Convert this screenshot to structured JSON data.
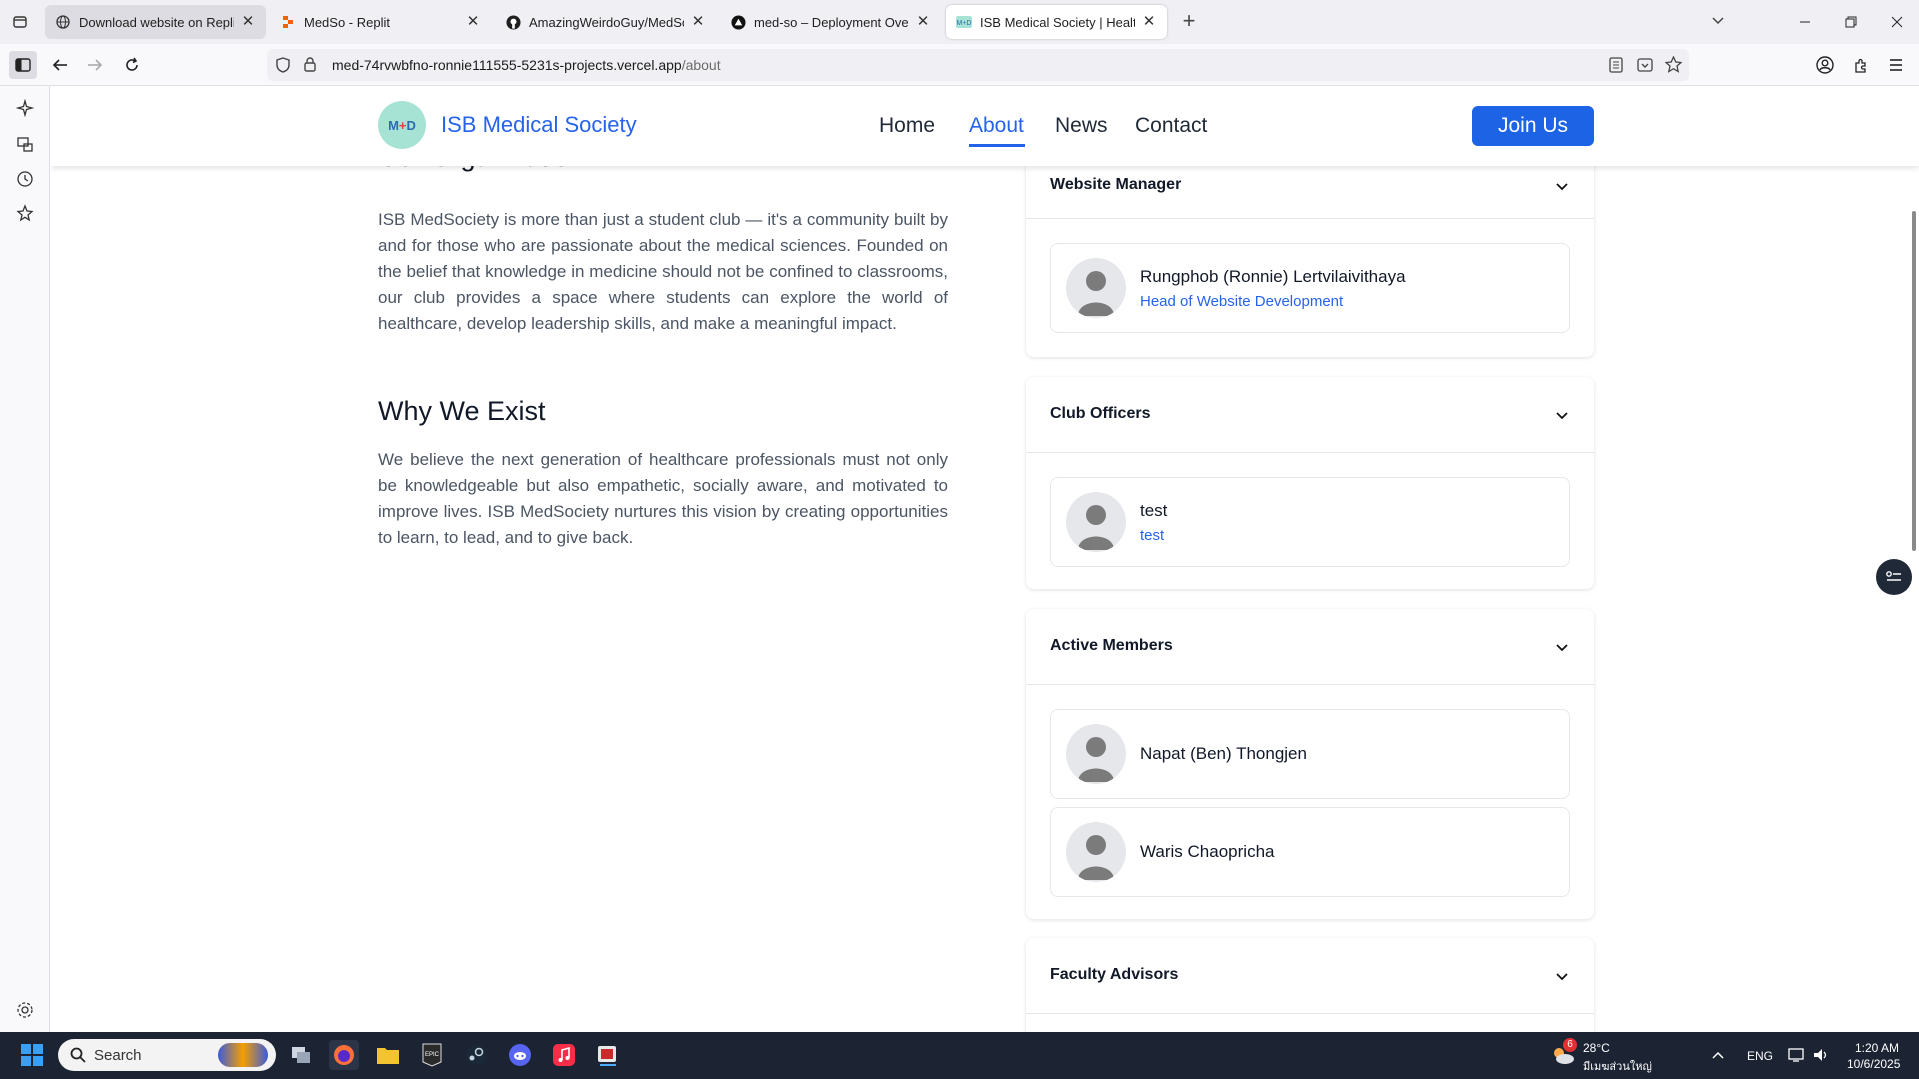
{
  "browser": {
    "tabs": [
      {
        "title": "Download website on Replit",
        "icon": "globe-icon"
      },
      {
        "title": "MedSo - Replit",
        "icon": "replit-icon"
      },
      {
        "title": "AmazingWeirdoGuy/MedSo",
        "icon": "github-icon"
      },
      {
        "title": "med-so – Deployment Overview",
        "icon": "vercel-icon"
      },
      {
        "title": "ISB Medical Society | Healthcare",
        "icon": "medsoc-icon",
        "active": true
      }
    ],
    "url_host": "med-74rvwbfno-ronnie111555-5231s-projects.vercel.app",
    "url_path": "/about"
  },
  "site": {
    "logo_text_m": "M",
    "logo_text_plus": "+",
    "logo_text_d": "D",
    "name": "ISB Medical Society",
    "nav": [
      {
        "label": "Home"
      },
      {
        "label": "About",
        "active": true
      },
      {
        "label": "News"
      },
      {
        "label": "Contact"
      }
    ],
    "join_label": "Join Us"
  },
  "about": {
    "org_heading": "Our Organization",
    "org_paragraph": "ISB MedSociety is more than just a student club — it's a community built by and for those who are passionate about the medical sciences. Founded on the belief that knowledge in medicine should not be confined to classrooms, our club provides a space where students can explore the world of healthcare, develop leadership skills, and make a meaningful impact.",
    "why_heading": "Why We Exist",
    "why_paragraph": "We believe the next generation of healthcare professionals must not only be knowledgeable but also empathetic, socially aware, and motivated to improve lives. ISB MedSociety nurtures this vision by creating opportunities to learn, to lead, and to give back."
  },
  "team": {
    "website_manager": {
      "title": "Website Manager",
      "members": [
        {
          "name": "Rungphob (Ronnie) Lertvilaivithaya",
          "role": "Head of Website Development"
        }
      ]
    },
    "club_officers": {
      "title": "Club Officers",
      "members": [
        {
          "name": "test",
          "role": "test"
        }
      ]
    },
    "active_members": {
      "title": "Active Members",
      "members": [
        {
          "name": "Napat (Ben) Thongjen"
        },
        {
          "name": "Waris Chaopricha"
        }
      ]
    },
    "faculty_advisors": {
      "title": "Faculty Advisors"
    }
  },
  "taskbar": {
    "search_label": "Search",
    "weather_badge": "6",
    "temperature": "28°C",
    "weather_desc": "มีเมฆส่วนใหญ่",
    "language": "ENG",
    "time": "1:20 AM",
    "date": "10/6/2025"
  },
  "colors": {
    "brand_blue": "#2563eb",
    "join_button": "#1d63e6",
    "logo_bg": "#a7e3d4",
    "taskbar_bg": "#1c2434"
  }
}
